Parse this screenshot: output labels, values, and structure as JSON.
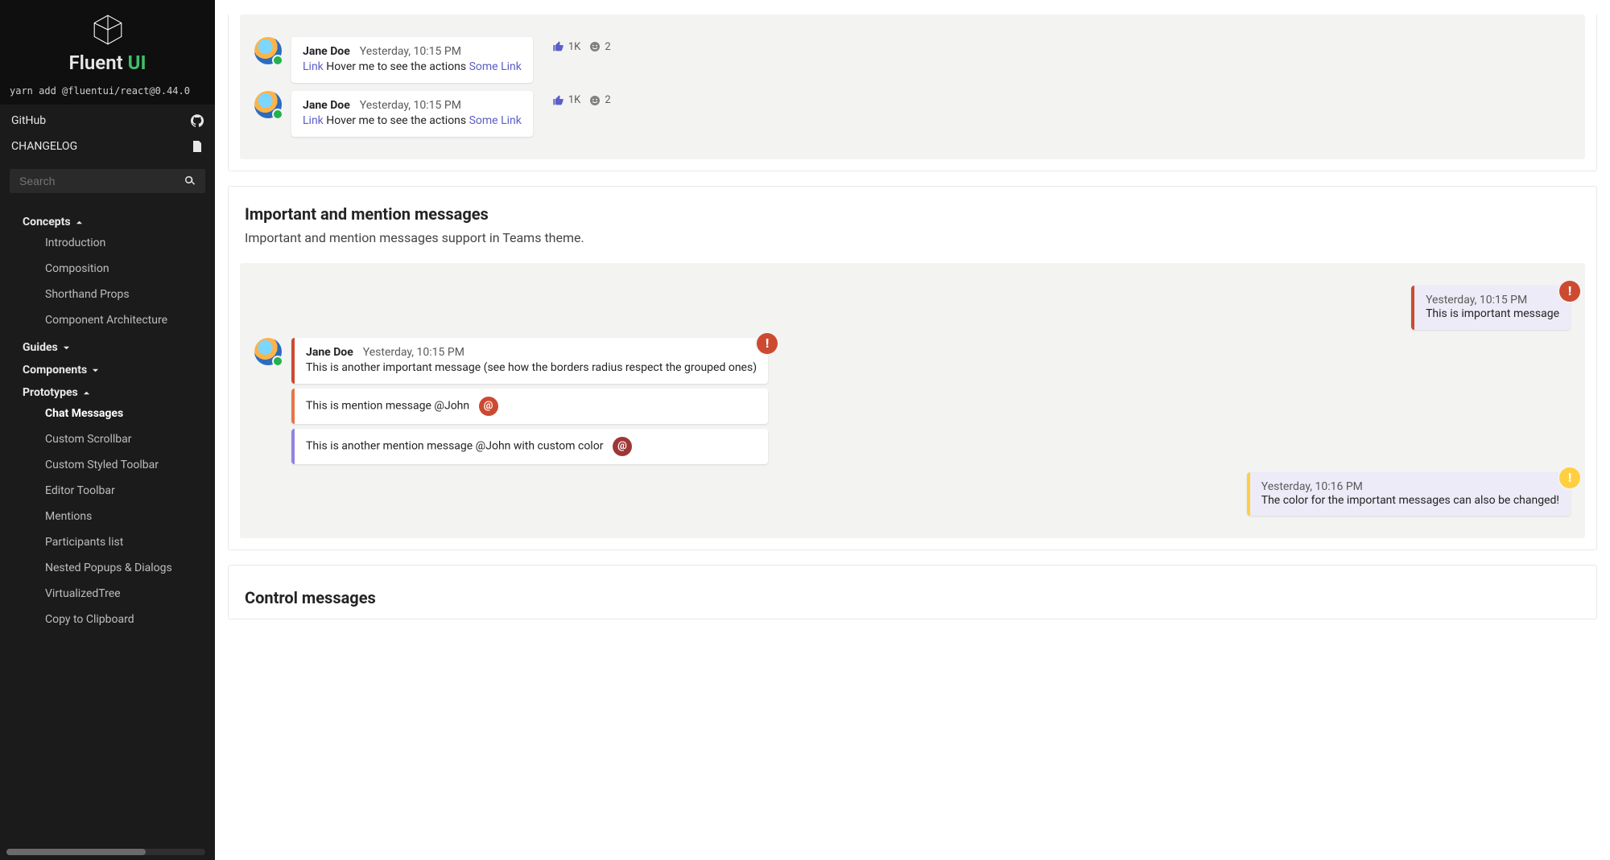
{
  "sidebar": {
    "product_a": "Fluent",
    "product_b": "UI",
    "install": "yarn add @fluentui/react@0.44.0",
    "links": {
      "github": "GitHub",
      "changelog": "CHANGELOG"
    },
    "search_placeholder": "Search",
    "groups": {
      "concepts": "Concepts",
      "guides": "Guides",
      "components": "Components",
      "prototypes": "Prototypes"
    },
    "concepts_items": [
      "Introduction",
      "Composition",
      "Shorthand Props",
      "Component Architecture"
    ],
    "prototypes_items": [
      "Chat Messages",
      "Custom Scrollbar",
      "Custom Styled Toolbar",
      "Editor Toolbar",
      "Mentions",
      "Participants list",
      "Nested Popups & Dialogs",
      "VirtualizedTree",
      "Copy to Clipboard"
    ]
  },
  "section1": {
    "msg1": {
      "author": "Jane Doe",
      "time": "Yesterday, 10:15 PM",
      "link_a": "Link",
      "text": " Hover me to see the actions ",
      "link_b": "Some Link",
      "react_like": "1K",
      "react_smile": "2"
    },
    "msg2": {
      "author": "Jane Doe",
      "time": "Yesterday, 10:15 PM",
      "link_a": "Link",
      "text": " Hover me to see the actions ",
      "link_b": "Some Link",
      "react_like": "1K",
      "react_smile": "2"
    }
  },
  "section2": {
    "title": "Important and mention messages",
    "desc": "Important and mention messages support in Teams theme.",
    "mine1": {
      "time": "Yesterday, 10:15 PM",
      "text": "This is important message"
    },
    "msg_jane": {
      "author": "Jane Doe",
      "time": "Yesterday, 10:15 PM",
      "text": "This is another important message (see how the borders radius respect the grouped ones)"
    },
    "mention1": {
      "text": "This is mention message @John"
    },
    "mention2": {
      "text": "This is another mention message @John with custom color"
    },
    "mine2": {
      "time": "Yesterday, 10:16 PM",
      "text": "The color for the important messages can also be changed!"
    }
  },
  "section3": {
    "title": "Control messages"
  }
}
